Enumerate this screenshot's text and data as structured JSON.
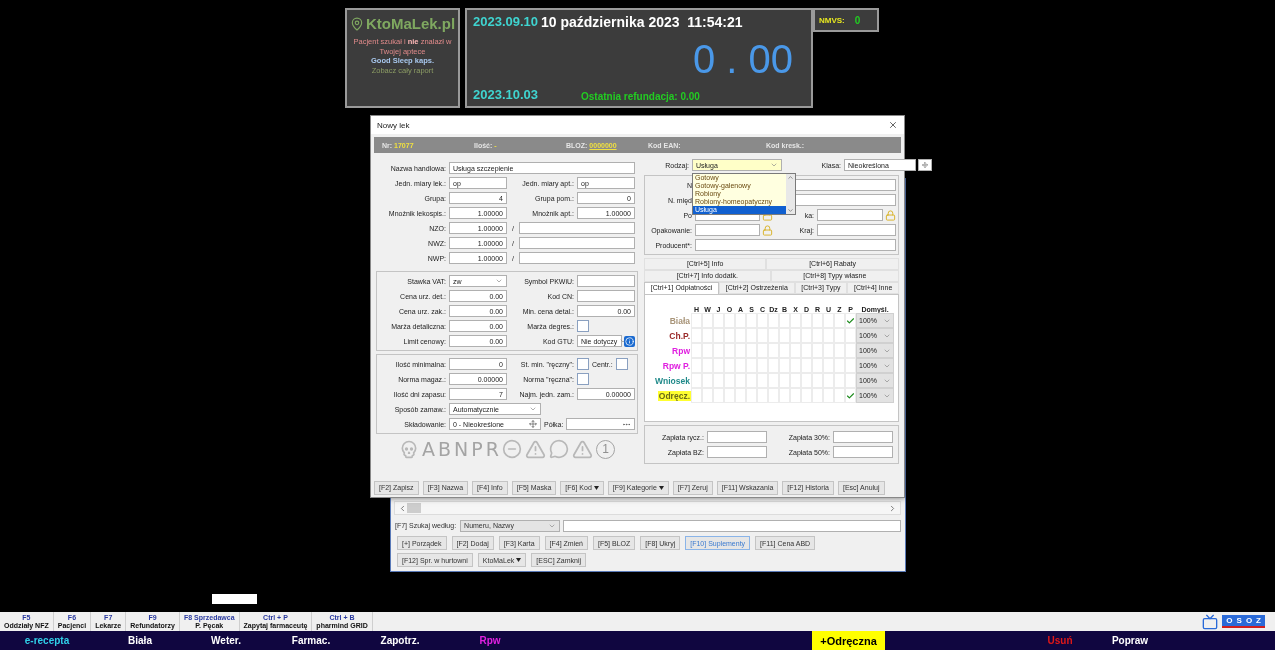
{
  "header": {
    "logo": {
      "brand": "KtoMaLek.pl",
      "lines": [
        {
          "kind": "alert",
          "text": "Pacjent szukał i **nie** znalazł w Twojej aptece"
        },
        {
          "kind": "product",
          "text": "Good Sleep kaps."
        },
        {
          "kind": "link",
          "text": "Zobacz cały raport"
        }
      ]
    },
    "summary": {
      "date_from": "2023.09.10",
      "now": "10 października 2023  11:54:21",
      "total": "0 . 00",
      "date_to": "2023.10.03",
      "last_refund": "Ostatnia refundacja: 0.00"
    },
    "nmvs": {
      "label": "NMVS:",
      "value": "0"
    }
  },
  "dialog": {
    "title": "Nowy lek",
    "info_bar": [
      {
        "label": "Nr:",
        "value": "17077",
        "link": false
      },
      {
        "label": "Ilość:",
        "value": "-",
        "link": false
      },
      {
        "label": "BLOZ:",
        "value": "0000000",
        "link": true
      },
      {
        "label": "Kod EAN:"
      },
      {
        "label": "Kod kresk.:"
      }
    ],
    "left_sections": [
      {
        "framed": false,
        "rows": [
          [
            {
              "kind": "label",
              "text": "Nazwa handlowa:"
            },
            {
              "kind": "text-wide",
              "value": "Usługa szczepienie"
            }
          ],
          [
            {
              "kind": "label",
              "text": "Jedn. miary lek.:"
            },
            {
              "kind": "text",
              "value": "op"
            },
            {
              "kind": "label",
              "text": "Jedn. miary apt.:"
            },
            {
              "kind": "text",
              "value": "op"
            }
          ],
          [
            {
              "kind": "label",
              "text": "Grupa:"
            },
            {
              "kind": "number",
              "value": "4"
            },
            {
              "kind": "label",
              "text": "Grupa pom.:"
            },
            {
              "kind": "number",
              "value": "0"
            }
          ],
          [
            {
              "kind": "label",
              "text": "Mnożnik lekospis.:"
            },
            {
              "kind": "number",
              "value": "1.00000"
            },
            {
              "kind": "label",
              "text": "Mnożnik apt.:"
            },
            {
              "kind": "number",
              "value": "1.00000"
            }
          ],
          [
            {
              "kind": "label",
              "text": "NZO:"
            },
            {
              "kind": "number",
              "value": "1.00000"
            },
            {
              "kind": "slash",
              "text": "/"
            },
            {
              "kind": "text-wide"
            }
          ],
          [
            {
              "kind": "label",
              "text": "NWZ:"
            },
            {
              "kind": "number",
              "value": "1.00000"
            },
            {
              "kind": "slash",
              "text": "/"
            },
            {
              "kind": "text-wide"
            }
          ],
          [
            {
              "kind": "label",
              "text": "NWP:"
            },
            {
              "kind": "number",
              "value": "1.00000"
            },
            {
              "kind": "slash",
              "text": "/"
            },
            {
              "kind": "text-wide"
            }
          ]
        ]
      },
      {
        "framed": true,
        "rows": [
          [
            {
              "kind": "label",
              "text": "Stawka VAT:"
            },
            {
              "kind": "select",
              "value": "zw"
            },
            {
              "kind": "label",
              "text": "Symbol PKWiU:"
            },
            {
              "kind": "text"
            }
          ],
          [
            {
              "kind": "label",
              "text": "Cena urz. det.:"
            },
            {
              "kind": "number",
              "value": "0.00"
            },
            {
              "kind": "label",
              "text": "Kod CN:"
            },
            {
              "kind": "text"
            }
          ],
          [
            {
              "kind": "label",
              "text": "Cena urz. zak.:"
            },
            {
              "kind": "number",
              "value": "0.00"
            },
            {
              "kind": "label",
              "text": "Min. cena detal.:"
            },
            {
              "kind": "number",
              "value": "0.00"
            }
          ],
          [
            {
              "kind": "label",
              "text": "Marża detaliczna:"
            },
            {
              "kind": "number",
              "value": "0.00"
            },
            {
              "kind": "label",
              "text": "Marża degres.:"
            },
            {
              "kind": "checkbox",
              "checked": false
            }
          ],
          [
            {
              "kind": "label",
              "text": "Limit cenowy:"
            },
            {
              "kind": "number",
              "value": "0.00"
            },
            {
              "kind": "label",
              "text": "Kod GTU:"
            },
            {
              "kind": "select",
              "value": "Nie dotyczy"
            },
            {
              "kind": "info"
            }
          ]
        ]
      },
      {
        "framed": true,
        "rows": [
          [
            {
              "kind": "label",
              "text": "Ilość minimalna:"
            },
            {
              "kind": "number",
              "value": "0"
            },
            {
              "kind": "label",
              "text": "St. min. \"ręczny\":"
            },
            {
              "kind": "checkbox",
              "checked": false
            },
            {
              "kind": "label",
              "text": "Centr.:"
            },
            {
              "kind": "checkbox",
              "checked": false
            }
          ],
          [
            {
              "kind": "label",
              "text": "Norma magaz.:"
            },
            {
              "kind": "number",
              "value": "0.00000"
            },
            {
              "kind": "label",
              "text": "Norma \"ręczna\":"
            },
            {
              "kind": "checkbox",
              "checked": false
            }
          ],
          [
            {
              "kind": "label",
              "text": "Ilość dni zapasu:"
            },
            {
              "kind": "number",
              "value": "7"
            },
            {
              "kind": "label",
              "text": "Najm. jedn. zam.:"
            },
            {
              "kind": "number",
              "value": "0.00000"
            }
          ],
          [
            {
              "kind": "label",
              "text": "Sposób zamaw.:"
            },
            {
              "kind": "select-long",
              "value": "Automatycznie"
            }
          ],
          [
            {
              "kind": "label",
              "text": "Składowanie:"
            },
            {
              "kind": "lookup",
              "value": "0 - Nieokreślone"
            },
            {
              "kind": "label",
              "text": "Półka:"
            },
            {
              "kind": "browse"
            }
          ]
        ]
      }
    ],
    "markers": [
      {
        "kind": "skull"
      },
      {
        "kind": "letter",
        "text": "A"
      },
      {
        "kind": "letter",
        "text": "B"
      },
      {
        "kind": "letter",
        "text": "N"
      },
      {
        "kind": "letter",
        "text": "P"
      },
      {
        "kind": "letter",
        "text": "R"
      },
      {
        "kind": "no-entry"
      },
      {
        "kind": "warning"
      },
      {
        "kind": "bubble"
      },
      {
        "kind": "warning"
      },
      {
        "kind": "number",
        "text": "1"
      }
    ],
    "kind_select": {
      "label": "Rodzaj:",
      "value": "Usługa",
      "options": [
        {
          "text": "Gotowy",
          "selected": false
        },
        {
          "text": "Gotowy-galenowy",
          "selected": false
        },
        {
          "text": "Robiony",
          "selected": false
        },
        {
          "text": "Robiony-homeopatyczny",
          "selected": false
        },
        {
          "text": "Usługa",
          "selected": true
        }
      ]
    },
    "class_select": {
      "label": "Klasa:",
      "value": "Nieokreślona"
    },
    "right_rows": [
      [
        {
          "kind": "label",
          "text": "N"
        },
        {
          "kind": "text-wide"
        }
      ],
      [
        {
          "kind": "label",
          "text": "N. międ"
        },
        {
          "kind": "text-wide"
        }
      ],
      [
        {
          "kind": "label",
          "text": "Po"
        },
        {
          "kind": "text"
        },
        {
          "kind": "lock"
        },
        {
          "kind": "label",
          "text": "ka:"
        },
        {
          "kind": "text"
        },
        {
          "kind": "lock"
        }
      ],
      [
        {
          "kind": "label",
          "text": "Opakowanie:"
        },
        {
          "kind": "text"
        },
        {
          "kind": "lock"
        },
        {
          "kind": "label",
          "text": "Kraj:"
        },
        {
          "kind": "text"
        }
      ],
      [
        {
          "kind": "label",
          "text": "Producent*:"
        },
        {
          "kind": "text-wide"
        }
      ]
    ],
    "tab_rows": [
      [
        {
          "label": "[Ctrl+5] Info",
          "selected": false
        },
        {
          "label": "[Ctrl+6] Rabaty",
          "selected": false
        }
      ],
      [
        {
          "label": "[Ctrl+7] Info dodatk.",
          "selected": false
        },
        {
          "label": "[Ctrl+8] Typy własne",
          "selected": false
        }
      ],
      [
        {
          "label": "[Ctrl+1] Odpłatności",
          "selected": true
        },
        {
          "label": "[Ctrl+2] Ostrzeżenia",
          "selected": false
        },
        {
          "label": "[Ctrl+3] Typy",
          "selected": false
        },
        {
          "label": "[Ctrl+4] Inne",
          "selected": false
        }
      ]
    ],
    "grid": {
      "columns": [
        "H",
        "W",
        "J",
        "O",
        "A",
        "S",
        "C",
        "Dz",
        "B",
        "X",
        "D",
        "R",
        "U",
        "Z",
        "P"
      ],
      "default_header": "Domyśl.",
      "rows": [
        {
          "label": "Biała",
          "color": "#a89478",
          "highlighted": false,
          "default": "100%",
          "checks": [
            false,
            false,
            false,
            false,
            false,
            false,
            false,
            false,
            false,
            false,
            false,
            false,
            false,
            false,
            true
          ]
        },
        {
          "label": "Ch.P.",
          "color": "#9a2a2a",
          "highlighted": false,
          "default": "100%",
          "checks": [
            false,
            false,
            false,
            false,
            false,
            false,
            false,
            false,
            false,
            false,
            false,
            false,
            false,
            false,
            false
          ]
        },
        {
          "label": "Rpw",
          "color": "#e020e0",
          "highlighted": false,
          "default": "100%",
          "checks": [
            false,
            false,
            false,
            false,
            false,
            false,
            false,
            false,
            false,
            false,
            false,
            false,
            false,
            false,
            false
          ]
        },
        {
          "label": "Rpw P.",
          "color": "#e020e0",
          "highlighted": false,
          "default": "100%",
          "checks": [
            false,
            false,
            false,
            false,
            false,
            false,
            false,
            false,
            false,
            false,
            false,
            false,
            false,
            false,
            false
          ]
        },
        {
          "label": "Wniosek",
          "color": "#208a8a",
          "highlighted": false,
          "default": "100%",
          "checks": [
            false,
            false,
            false,
            false,
            false,
            false,
            false,
            false,
            false,
            false,
            false,
            false,
            false,
            false,
            false
          ]
        },
        {
          "label": "Odręcz.",
          "highlighted": true,
          "default": "100%",
          "checks": [
            false,
            false,
            false,
            false,
            false,
            false,
            false,
            false,
            false,
            false,
            false,
            false,
            false,
            false,
            true
          ]
        }
      ]
    },
    "payments": [
      {
        "label": "Zapłata rycz.:"
      },
      {
        "label": "Zapłata 30%:"
      },
      {
        "label": "Zapłata BZ:"
      },
      {
        "label": "Zapłata 50%:"
      }
    ],
    "buttons": [
      {
        "label": "[F2] Zapisz",
        "dropdown": false
      },
      {
        "label": "[F3] Nazwa",
        "dropdown": false
      },
      {
        "label": "[F4] Info",
        "dropdown": false
      },
      {
        "label": "[F5] Maska",
        "dropdown": false
      },
      {
        "label": "[F6] Kod",
        "dropdown": true
      },
      {
        "label": "[F9] Kategorie",
        "dropdown": true
      },
      {
        "label": "[F7] Zeruj",
        "dropdown": false
      },
      {
        "label": "[F11] Wskazania",
        "dropdown": false
      },
      {
        "label": "[F12] Historia",
        "dropdown": false
      },
      {
        "label": "[Esc] Anuluj",
        "dropdown": false
      }
    ]
  },
  "back_window": {
    "search": {
      "label": "[F7] Szukaj według:",
      "mode": "Numeru, Nazwy"
    },
    "button_rows": [
      [
        {
          "label": "[+] Porządek",
          "active": false,
          "dropdown": false
        },
        {
          "label": "[F2] Dodaj",
          "active": false,
          "dropdown": false
        },
        {
          "label": "[F3] Karta",
          "active": false,
          "dropdown": false
        },
        {
          "label": "[F4] Zmień",
          "active": false,
          "dropdown": false
        },
        {
          "label": "[F5] BLOZ",
          "active": false,
          "dropdown": false
        },
        {
          "label": "[F8] Ukryj",
          "active": false,
          "dropdown": false
        },
        {
          "label": "[F10] Suplementy",
          "active": true,
          "dropdown": false
        },
        {
          "label": "[F11] Cena ABD",
          "active": false,
          "dropdown": false
        }
      ],
      [
        {
          "label": "[F12] Spr. w hurtowni",
          "active": false,
          "dropdown": false
        },
        {
          "label": "KtoMaLek",
          "active": false,
          "dropdown": true
        },
        {
          "label": "[ESC] Zamknij",
          "active": false,
          "dropdown": false
        }
      ]
    ]
  },
  "function_bar": {
    "items": [
      {
        "key": "F5",
        "label": "Oddziały NFZ"
      },
      {
        "key": "F6",
        "label": "Pacjenci"
      },
      {
        "key": "F7",
        "label": "Lekarze"
      },
      {
        "key": "F9",
        "label": "Refundatorzy"
      },
      {
        "key": "F8 Sprzedawca",
        "label": "P. Pęcak"
      },
      {
        "key": "Ctrl + P",
        "label": "Zapytaj farmaceutę"
      },
      {
        "key": "Ctrl + B",
        "label": "pharmind GRID"
      }
    ],
    "logo_text": "OSOZ"
  },
  "nav_bar": [
    {
      "label": "e-recepta",
      "color": "#30d0e8",
      "highlighted": false
    },
    {
      "label": "Biała",
      "color": "#ffffff",
      "highlighted": false
    },
    {
      "label": "Weter.",
      "color": "#ffffff",
      "highlighted": false
    },
    {
      "label": "Farmac.",
      "color": "#ffffff",
      "highlighted": false
    },
    {
      "label": "Zapotrz.",
      "color": "#ffffff",
      "highlighted": false
    },
    {
      "label": "Rpw",
      "color": "#e020e0",
      "highlighted": false
    },
    {
      "label": "+Odręczna",
      "highlighted": true
    },
    {
      "label": "Usuń",
      "color": "#e01818",
      "highlighted": false
    },
    {
      "label": "Popraw",
      "color": "#ffffff",
      "highlighted": false
    }
  ]
}
